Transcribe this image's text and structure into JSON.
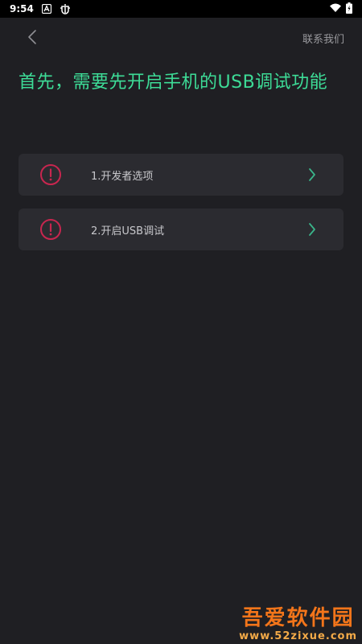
{
  "status_bar": {
    "time": "9:54",
    "icons": [
      "letter-a-icon",
      "bug-icon",
      "wifi-icon",
      "battery-icon"
    ]
  },
  "header": {
    "back_icon": "chevron-left-icon",
    "contact_label": "联系我们"
  },
  "title": "首先，需要先开启手机的USB调试功能",
  "steps": [
    {
      "label": "1.开发者选项",
      "icon": "warning-circle-icon"
    },
    {
      "label": "2.开启USB调试",
      "icon": "warning-circle-icon"
    }
  ],
  "watermark": {
    "title": "吾爱软件园",
    "url": "www.52zixue.com"
  },
  "colors": {
    "background": "#1f1f23",
    "card": "#2b2b30",
    "accent": "#3ddc97",
    "warning": "#c8264f",
    "chevron": "#3ab58a"
  }
}
